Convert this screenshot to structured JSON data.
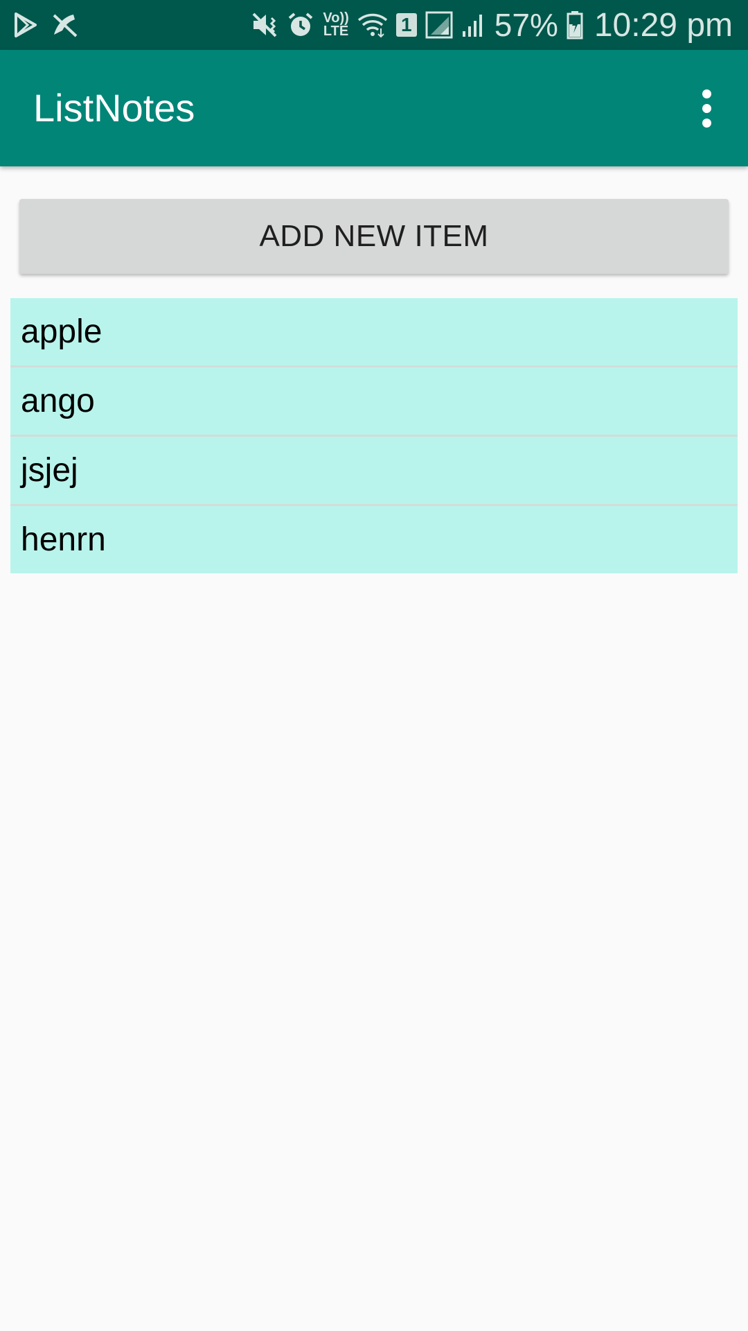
{
  "status_bar": {
    "left_icons": [
      "play-store-icon",
      "missed-call-muted-icon"
    ],
    "right_icons": [
      "vibrate-mute-icon",
      "alarm-icon",
      "volte-icon",
      "wifi-icon",
      "sim-1-icon",
      "signal-1-icon",
      "signal-2-icon",
      "battery-charging-icon"
    ],
    "volte_top": "Vo))",
    "volte_bottom": "LTE",
    "sim_number": "1",
    "battery_percent": "57%",
    "time": "10:29 pm"
  },
  "app_bar": {
    "title": "ListNotes",
    "menu_icon": "overflow-menu-icon"
  },
  "add_button": {
    "label": "ADD NEW ITEM"
  },
  "list": {
    "items": [
      {
        "label": "apple"
      },
      {
        "label": "ango"
      },
      {
        "label": "jsjej"
      },
      {
        "label": "henrn"
      }
    ]
  },
  "colors": {
    "status_bar_bg": "#00574b",
    "app_bar_bg": "#008577",
    "list_item_bg": "#b8f4ec",
    "button_bg": "#d6d7d7",
    "page_bg": "#fafafa"
  }
}
